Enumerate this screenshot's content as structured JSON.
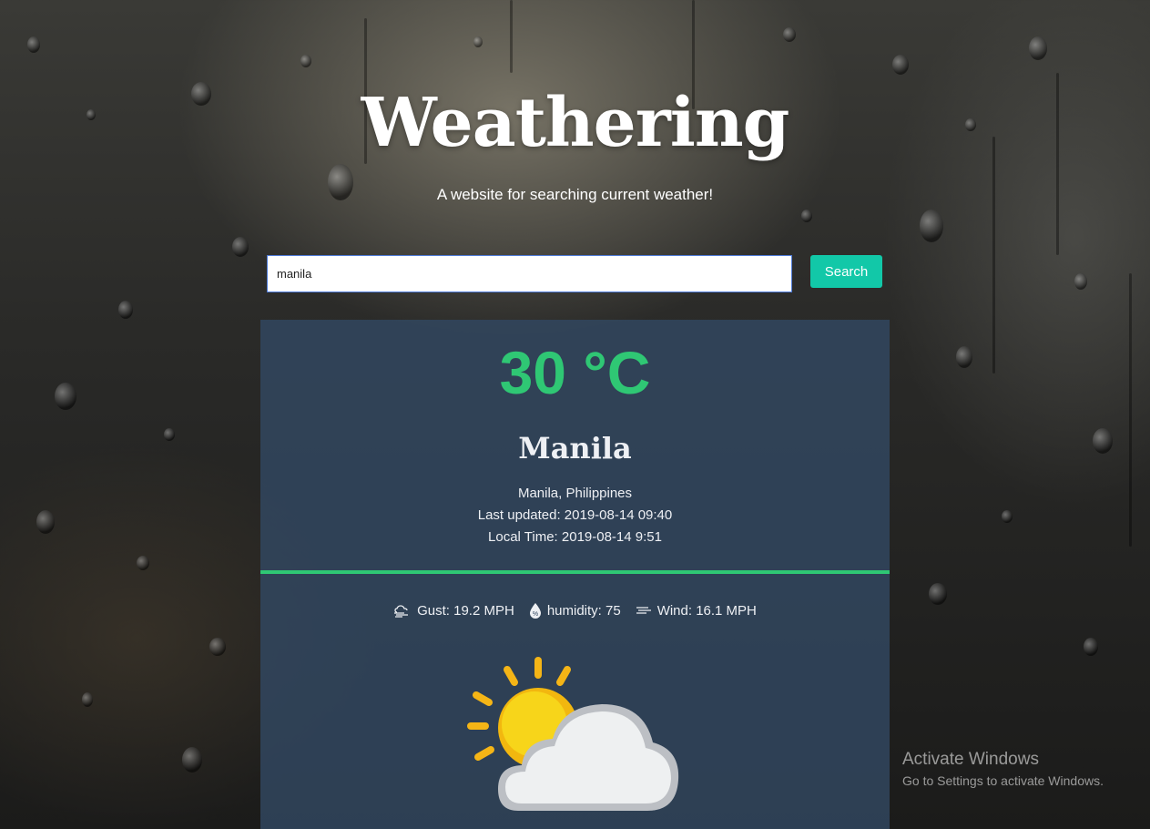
{
  "header": {
    "title": "Weathering",
    "subtitle": "A website for searching current weather!"
  },
  "search": {
    "value": "manila",
    "button_label": "Search"
  },
  "weather": {
    "temperature": "30 °C",
    "city": "Manila",
    "location": "Manila, Philippines",
    "last_updated": "Last updated: 2019-08-14 09:40",
    "local_time": "Local Time: 2019-08-14 9:51",
    "gust": "Gust: 19.2 MPH",
    "humidity": "humidity: 75",
    "wind": "Wind: 16.1 MPH",
    "condition_icon": "partly-cloudy-icon"
  },
  "colors": {
    "accent": "#2fc774",
    "button": "#12c8a8",
    "card": "#324862"
  },
  "watermark": {
    "title": "Activate Windows",
    "subtitle": "Go to Settings to activate Windows."
  }
}
